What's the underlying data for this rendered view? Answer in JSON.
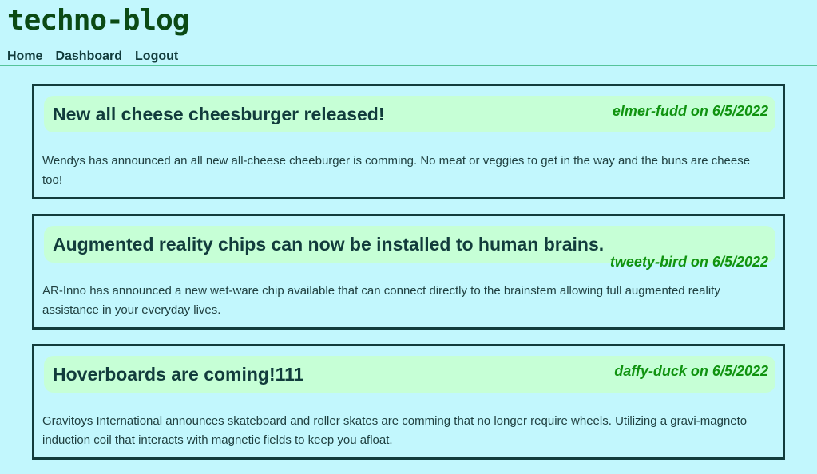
{
  "site": {
    "title": "techno-blog"
  },
  "nav": {
    "items": [
      {
        "label": "Home"
      },
      {
        "label": "Dashboard"
      },
      {
        "label": "Logout"
      }
    ]
  },
  "posts": [
    {
      "title": "New all cheese cheesburger released!",
      "author": "elmer-fudd",
      "date": "6/5/2022",
      "meta": "elmer-fudd on 6/5/2022",
      "body": "Wendys has announced an all new all-cheese cheeburger is comming. No meat or veggies to get in the way and the buns are cheese too!"
    },
    {
      "title": "Augmented reality chips can now be installed to human brains.",
      "author": "tweety-bird",
      "date": "6/5/2022",
      "meta": "tweety-bird on 6/5/2022",
      "body": "AR-Inno has announced a new wet-ware chip available that can connect directly to the brainstem allowing full augmented reality assistance in your everyday lives."
    },
    {
      "title": "Hoverboards are coming!111",
      "author": "daffy-duck",
      "date": "6/5/2022",
      "meta": "daffy-duck on 6/5/2022",
      "body": "Gravitoys International announces skateboard and roller skates are comming that no longer require wheels. Utilizing a gravi-magneto induction coil that interacts with magnetic fields to keep you afloat."
    }
  ],
  "colors": {
    "background": "#c2f7fd",
    "post_header": "#c6ffd6",
    "meta_text": "#109310",
    "border": "#123c3c",
    "logo": "#0b4a14"
  }
}
